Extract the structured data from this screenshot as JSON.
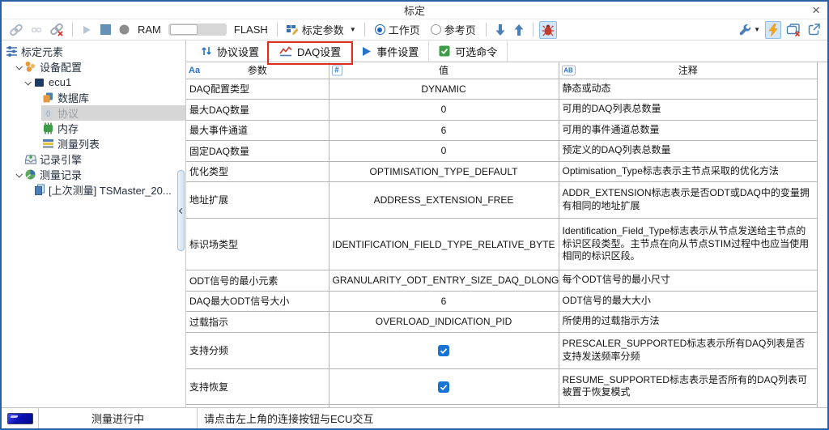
{
  "window": {
    "title": "标定",
    "close_glyph": "×"
  },
  "toolbar": {
    "ram_label": "RAM",
    "flash_label": "FLASH",
    "calib_params_label": "标定参数",
    "radio_work": "工作页",
    "radio_ref": "参考页",
    "icon_names": [
      "connect-icon",
      "link-idle-icon",
      "disconnect-icon",
      "play-icon",
      "stop-icon",
      "record-icon",
      "ram-flash-slider",
      "calibration-params-icon",
      "dropdown-caret-icon",
      "move-down-icon",
      "move-up-icon",
      "debug-bug-icon",
      "wrench-icon",
      "lightning-icon",
      "close-windows-icon",
      "external-link-icon"
    ]
  },
  "sidebar": {
    "items": [
      {
        "id": "calibration-elements",
        "label": "标定元素",
        "level": 0,
        "icon": "sliders"
      },
      {
        "id": "device-config",
        "label": "设备配置",
        "level": 1,
        "icon": "device-config",
        "expanded": true
      },
      {
        "id": "ecu1",
        "label": "ecu1",
        "level": 2,
        "icon": "ecu",
        "expanded": true
      },
      {
        "id": "database",
        "label": "数据库",
        "level": 3,
        "icon": "database"
      },
      {
        "id": "protocol",
        "label": "协议",
        "level": 3,
        "icon": "protocol",
        "selected": true
      },
      {
        "id": "memory",
        "label": "内存",
        "level": 3,
        "icon": "memory"
      },
      {
        "id": "measure-list",
        "label": "测量列表",
        "level": 3,
        "icon": "measure-list"
      },
      {
        "id": "record-engine",
        "label": "记录引擎",
        "level": 1,
        "icon": "record-engine"
      },
      {
        "id": "measure-record",
        "label": "测量记录",
        "level": 1,
        "icon": "measure-record",
        "expanded": true
      },
      {
        "id": "last-measurement",
        "label": "[上次测量] TSMaster_20...",
        "level": 2,
        "icon": "file-copy"
      }
    ]
  },
  "tabs": [
    {
      "id": "protocol-settings",
      "label": "协议设置",
      "icon": "updown"
    },
    {
      "id": "daq-settings",
      "label": "DAQ设置",
      "icon": "wave",
      "annotated": true
    },
    {
      "id": "event-settings",
      "label": "事件设置",
      "icon": "play-tab"
    },
    {
      "id": "optional-commands",
      "label": "可选命令",
      "icon": "check-tab"
    }
  ],
  "table": {
    "columns": [
      {
        "id": "param",
        "label": "参数",
        "icon": "aa",
        "glyph": "Aa",
        "icon_name": "text-type-icon"
      },
      {
        "id": "value",
        "label": "值",
        "icon": "num",
        "glyph": "#",
        "icon_name": "number-type-icon"
      },
      {
        "id": "comment",
        "label": "注释",
        "icon": "ab",
        "glyph": "AB",
        "icon_name": "comment-type-icon"
      }
    ],
    "rows": [
      {
        "param": "DAQ配置类型",
        "value": "DYNAMIC",
        "comment": "静态或动态"
      },
      {
        "param": "最大DAQ数量",
        "value": "0",
        "comment": "可用的DAQ列表总数量"
      },
      {
        "param": "最大事件通道",
        "value": "6",
        "comment": "可用的事件通道总数量"
      },
      {
        "param": "固定DAQ数量",
        "value": "0",
        "comment": "预定义的DAQ列表总数量"
      },
      {
        "param": "优化类型",
        "value": "OPTIMISATION_TYPE_DEFAULT",
        "comment": "Optimisation_Type标志表示主节点采取的优化方法"
      },
      {
        "param": "地址扩展",
        "value": "ADDRESS_EXTENSION_FREE",
        "comment": "ADDR_EXTENSION标志表示是否ODT或DAQ中的变量拥有相同的地址扩展"
      },
      {
        "param": "标识场类型",
        "value": "IDENTIFICATION_FIELD_TYPE_RELATIVE_BYTE",
        "comment": "Identification_Field_Type标志表示从节点发送给主节点的标识区段类型。主节点在向从节点STIM过程中也应当使用相同的标识区段。"
      },
      {
        "param": "ODT信号的最小元素",
        "value": "GRANULARITY_ODT_ENTRY_SIZE_DAQ_DLONG",
        "comment": "每个ODT信号的最小尺寸"
      },
      {
        "param": "DAQ最大ODT信号大小",
        "value": "6",
        "comment": "ODT信号的最大大小"
      },
      {
        "param": "过载指示",
        "value": "OVERLOAD_INDICATION_PID",
        "comment": "所使用的过载指示方法"
      },
      {
        "param": "支持分频",
        "checkbox": true,
        "comment": "PRESCALER_SUPPORTED标志表示所有DAQ列表是否支持发送频率分频"
      },
      {
        "param": "支持恢复",
        "checkbox": true,
        "comment": "RESUME_SUPPORTED标志表示是否所有的DAQ列表可被置于恢复模式"
      }
    ]
  },
  "statusbar": {
    "measure_status": "测量进行中",
    "message": "请点击左上角的连接按钮与ECU交互"
  },
  "colors": {
    "window_border": "#2b5fa3",
    "accent_blue": "#2673c8",
    "steel_blue": "#4a7fb5",
    "annotation_red": "#e02b1e",
    "checkbox_blue": "#1873d3",
    "selected_row_gray": "#d6d6d6",
    "bug_red": "#c23b2e",
    "lightning_yellow": "#f6a821",
    "green_check": "#3f9c46",
    "orange": "#e8993f",
    "status_led_blue": "#0b12b8"
  }
}
